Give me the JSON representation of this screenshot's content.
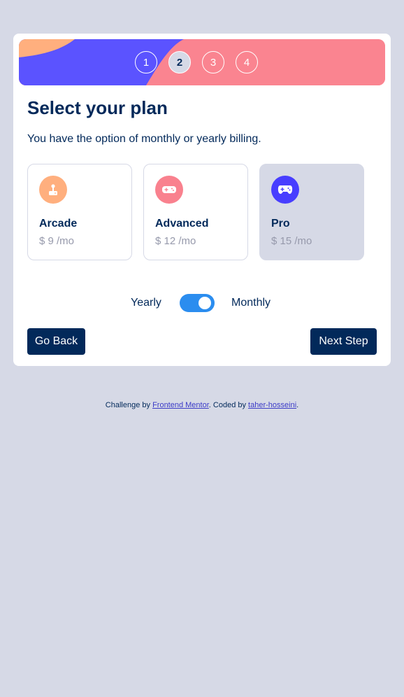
{
  "steps": [
    {
      "number": "1",
      "active": false
    },
    {
      "number": "2",
      "active": true
    },
    {
      "number": "3",
      "active": false
    },
    {
      "number": "4",
      "active": false
    }
  ],
  "heading": {
    "title": "Select your plan",
    "subtitle": "You have the option of monthly or yearly billing."
  },
  "plans": [
    {
      "name": "Arcade",
      "price": "$ 9 /mo",
      "icon": "joystick-icon",
      "color": "#ffaf7e",
      "selected": false
    },
    {
      "name": "Advanced",
      "price": "$ 12 /mo",
      "icon": "gamepad-icon",
      "color": "#f9818e",
      "selected": false
    },
    {
      "name": "Pro",
      "price": "$ 15 /mo",
      "icon": "controller-icon",
      "color": "#483eff",
      "selected": true
    }
  ],
  "billing": {
    "left_label": "Yearly",
    "right_label": "Monthly",
    "toggle_on": true
  },
  "buttons": {
    "back": "Go Back",
    "next": "Next Step"
  },
  "attribution": {
    "prefix": "Challenge by ",
    "link1": "Frontend Mentor",
    "middle": ". Coded by ",
    "link2": "taher-hosseini",
    "suffix": "."
  },
  "colors": {
    "primary": "#02295a",
    "page_bg": "#d6d9e6",
    "banner_purple": "#5b53ff",
    "banner_pink": "#fa8490",
    "banner_orange": "#ffaf7e",
    "toggle": "#2b8def"
  }
}
